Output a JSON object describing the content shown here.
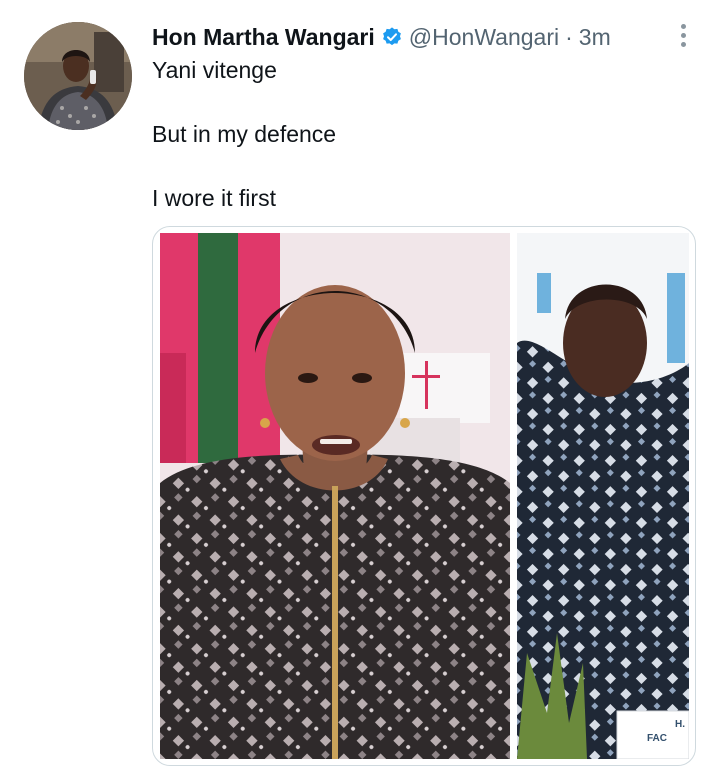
{
  "tweet": {
    "display_name": "Hon Martha Wangari",
    "handle": "@HonWangari",
    "separator": "·",
    "time": "3m",
    "paragraphs": [
      "Yani vitenge",
      "But in my defence",
      "I wore it first"
    ]
  },
  "icons": {
    "verified": "verified-badge-icon",
    "more": "more-options-icon"
  },
  "colors": {
    "verified": "#1d9bf0",
    "secondary_text": "#536471",
    "primary_text": "#0f1419"
  },
  "media": {
    "right_photo_sign": [
      "H.",
      "FAC"
    ]
  }
}
